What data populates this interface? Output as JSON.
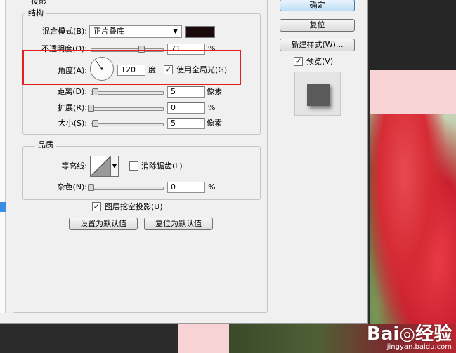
{
  "dialog": {
    "section_title": "投影",
    "structure": {
      "legend": "结构",
      "blend_mode_label": "混合模式(B):",
      "blend_mode_value": "正片叠底",
      "blend_color": "#1a0a0c",
      "opacity_label": "不透明度(O):",
      "opacity_value": "71",
      "opacity_unit": "%",
      "angle_label": "角度(A):",
      "angle_value": "120",
      "angle_unit": "度",
      "global_light_label": "使用全局光(G)",
      "global_light_checked": true,
      "distance_label": "距离(D):",
      "distance_value": "5",
      "distance_unit": "像素",
      "spread_label": "扩展(R):",
      "spread_value": "0",
      "spread_unit": "%",
      "size_label": "大小(S):",
      "size_value": "5",
      "size_unit": "像素"
    },
    "quality": {
      "legend": "品质",
      "contour_label": "等高线:",
      "anti_alias_label": "消除锯齿(L)",
      "anti_alias_checked": false,
      "noise_label": "杂色(N):",
      "noise_value": "0",
      "noise_unit": "%"
    },
    "knockout_label": "图层挖空投影(U)",
    "knockout_checked": true,
    "make_default_label": "设置为默认值",
    "reset_default_label": "复位为默认值"
  },
  "buttons": {
    "ok_label": "确定",
    "reset_label": "复位",
    "new_style_label": "新建样式(W)...",
    "preview_label": "预览(V)",
    "preview_checked": true
  },
  "watermark": {
    "logo": "Bai◎经验",
    "url": "jingyan.baidu.com"
  },
  "colors": {
    "highlight": "#e41f1f",
    "ok_button": "#bfe0f7"
  }
}
